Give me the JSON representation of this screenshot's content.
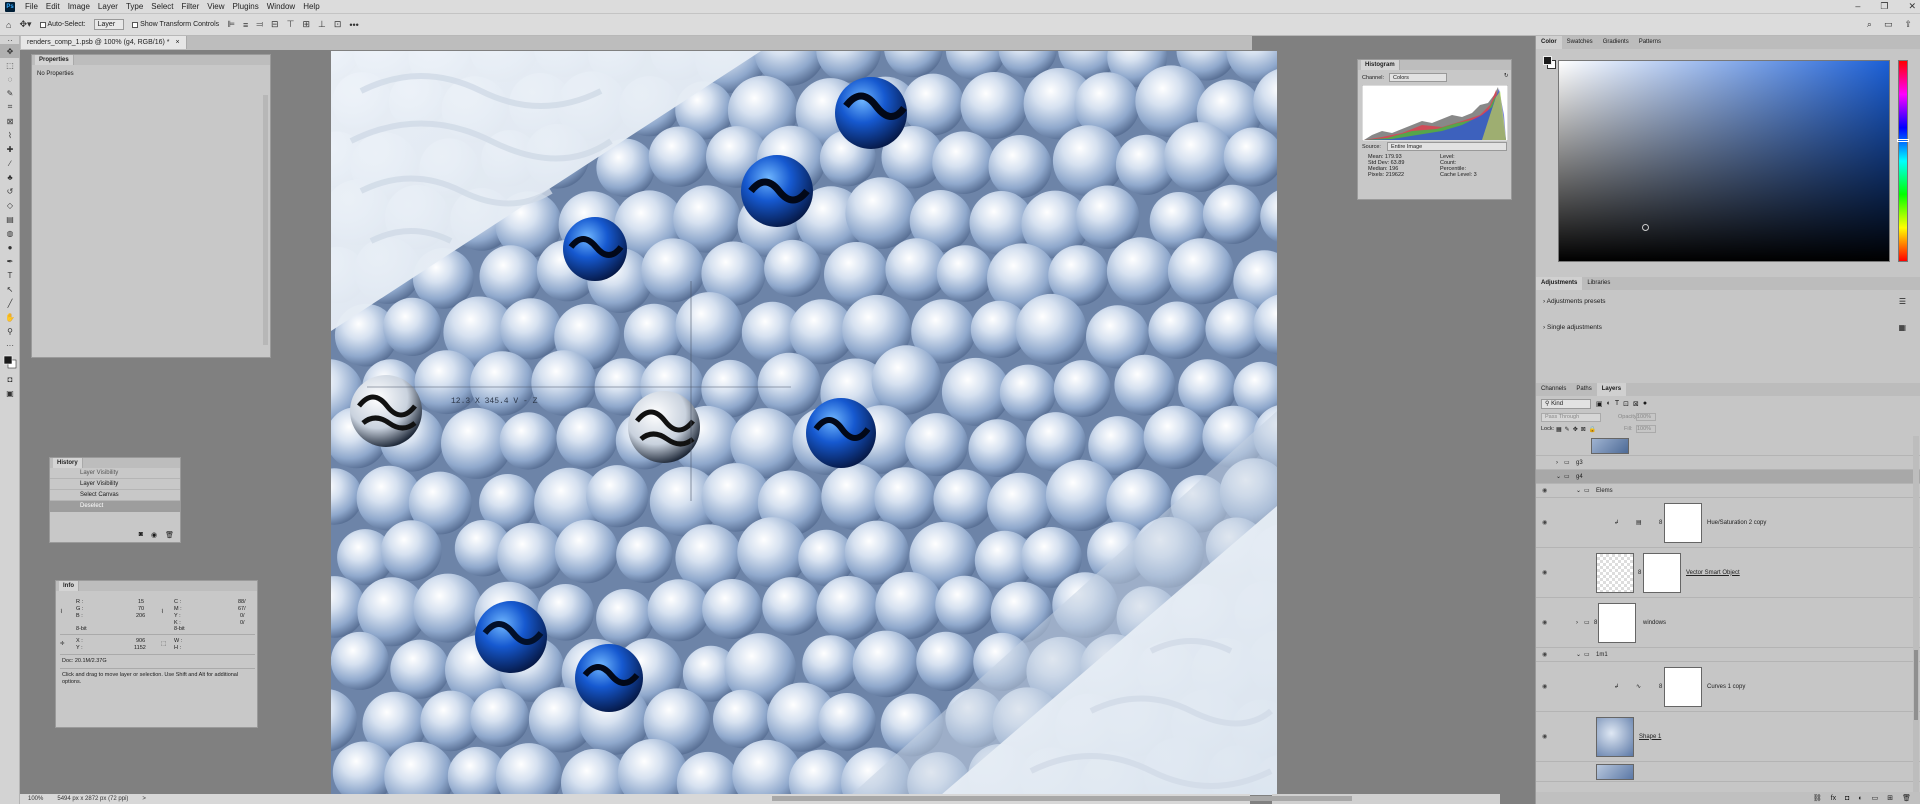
{
  "app": {
    "logo": "Ps",
    "doc_tab": "renders_comp_1.psb @ 100% (g4, RGB/16) *",
    "doc_tab_close": "×"
  },
  "menu": [
    "File",
    "Edit",
    "Image",
    "Layer",
    "Type",
    "Select",
    "Filter",
    "View",
    "Plugins",
    "Window",
    "Help"
  ],
  "window_controls": [
    "–",
    "❐",
    "✕"
  ],
  "options": {
    "auto_select": "Auto-Select:",
    "layer_select": "Layer",
    "show_transform": "Show Transform Controls",
    "more": "•••"
  },
  "properties": {
    "title": "Properties",
    "body": "No Properties"
  },
  "history": {
    "title": "History",
    "items": [
      "Layer Visibility",
      "Layer Visibility",
      "Select Canvas",
      "Deselect"
    ]
  },
  "info": {
    "title": "Info",
    "rgb": {
      "r": "R :",
      "g": "G :",
      "b": "B :",
      "rv": "15",
      "gv": "70",
      "bv": "206",
      "bit": "8-bit"
    },
    "cmyk": {
      "c": "C :",
      "m": "M :",
      "y": "Y :",
      "k": "K :",
      "cv": "88/",
      "mv": "67/",
      "yv": "0/",
      "kv": "0/",
      "bit": "8-bit"
    },
    "xy": {
      "x": "X :",
      "y": "Y :",
      "xv": "906",
      "yv": "1152"
    },
    "wh": {
      "w": "W :",
      "h": "H :"
    },
    "doc": "Doc: 20.1M/2.37G",
    "hint": "Click and drag to move layer or selection.  Use Shift and Alt for additional options."
  },
  "histogram": {
    "title": "Histogram",
    "channel_label": "Channel:",
    "channel": "Colors",
    "source_label": "Source:",
    "source": "Entire Image",
    "stats_left": [
      [
        "Mean:",
        "179.93"
      ],
      [
        "Std Dev:",
        "63.89"
      ],
      [
        "Median:",
        "196"
      ],
      [
        "Pixels:",
        "219622"
      ]
    ],
    "stats_right": [
      [
        "Level:",
        ""
      ],
      [
        "Count:",
        ""
      ],
      [
        "Percentile:",
        ""
      ],
      [
        "Cache Level:",
        "3"
      ]
    ]
  },
  "canvas_overlay": "12.3 X 345.4 V - Z",
  "status": {
    "zoom": "100%",
    "size": "5494 px x 2872 px (72 ppi)",
    "arrow": ">"
  },
  "color_panel": {
    "tabs": [
      "Color",
      "Swatches",
      "Gradients",
      "Patterns"
    ]
  },
  "adjustments": {
    "tabs": [
      "Adjustments",
      "Libraries"
    ],
    "presets": "Adjustments presets",
    "single": "Single adjustments"
  },
  "layers": {
    "tabs": [
      "Channels",
      "Paths",
      "Layers"
    ],
    "kind": "Kind",
    "blend": "Pass Through",
    "opacity_label": "Opacity:",
    "opacity": "100%",
    "lock_label": "Lock:",
    "fill_label": "Fill:",
    "fill": "100%",
    "rows": [
      "g3",
      "g4",
      "Elems",
      "Hue/Saturation 2 copy",
      "Vector Smart Object",
      "windows",
      "1m1",
      "Curves 1 copy",
      "Shape 1"
    ]
  },
  "colors": {
    "accent": "#31a8ff",
    "ui": "#c8c8c8",
    "hue_top": "#1b5fd6"
  }
}
